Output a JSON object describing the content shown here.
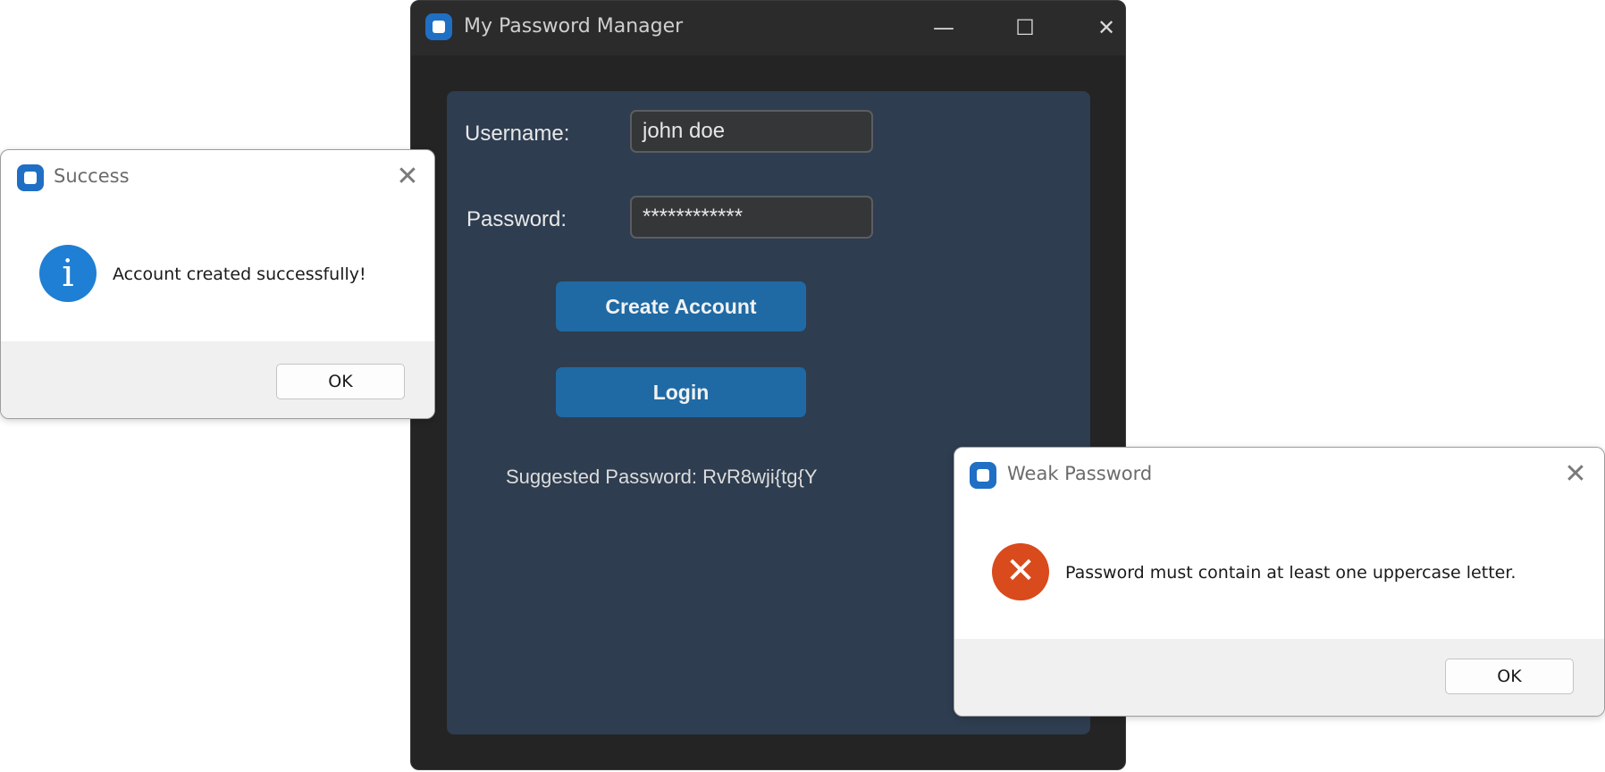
{
  "main_window": {
    "title": "My Password Manager",
    "minimize_glyph": "—",
    "maximize_glyph": "☐",
    "close_glyph": "✕",
    "username_label": "Username:",
    "username_value": "john doe",
    "password_label": "Password:",
    "password_value": "************",
    "create_account_label": "Create Account",
    "login_label": "Login",
    "suggested_password_text": "Suggested Password: RvR8wji{tg{Y"
  },
  "success_dialog": {
    "title": "Success",
    "message": "Account created successfully!",
    "ok_label": "OK",
    "close_glyph": "✕",
    "icon_glyph": "i"
  },
  "weak_password_dialog": {
    "title": "Weak Password",
    "message": "Password must contain at least one uppercase letter.",
    "ok_label": "OK",
    "close_glyph": "✕",
    "icon_glyph": "✕"
  },
  "colors": {
    "window_bg": "#242424",
    "panel_bg": "#2e3d50",
    "button_accent": "#1f6aa5",
    "info_icon": "#1e7fd4",
    "error_icon": "#d94a1c"
  }
}
